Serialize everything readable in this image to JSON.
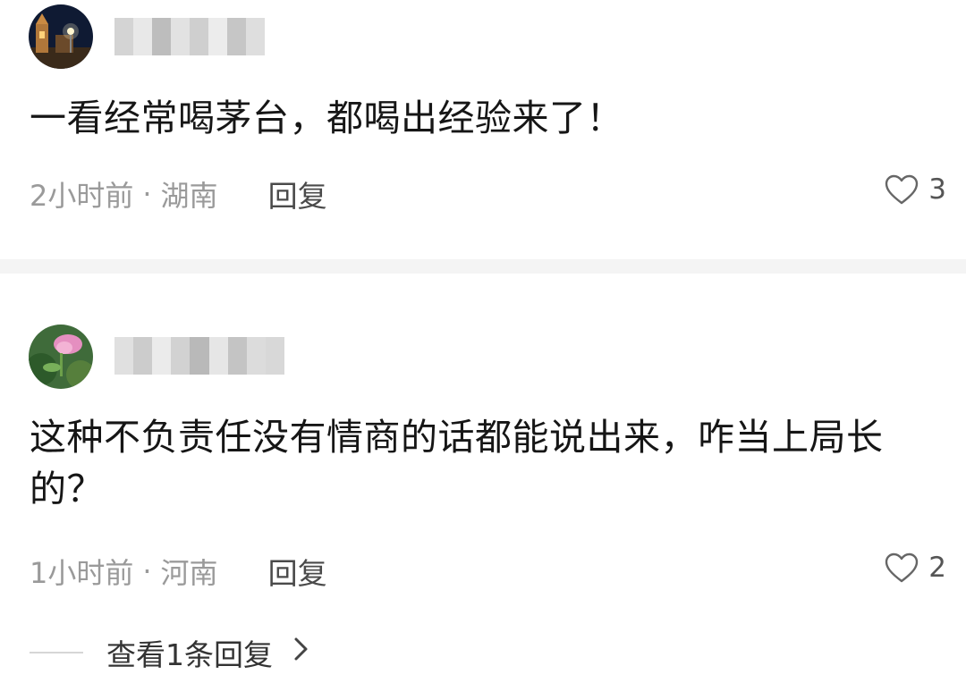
{
  "comments": [
    {
      "text": "一看经常喝茅台，都喝出经验来了！",
      "time": "2小时前",
      "separator": "·",
      "location": "湖南",
      "reply_label": "回复",
      "like_count": "3"
    },
    {
      "text": "这种不负责任没有情商的话都能说出来，咋当上局长的？",
      "time": "1小时前",
      "separator": "·",
      "location": "河南",
      "reply_label": "回复",
      "like_count": "2",
      "view_replies_label": "查看1条回复"
    }
  ],
  "icons": {
    "like": "heart-outline-icon",
    "chevron": "chevron-right-icon"
  },
  "colors": {
    "text": "#161616",
    "meta": "#9a9a9a",
    "divider": "#f4f4f4"
  }
}
